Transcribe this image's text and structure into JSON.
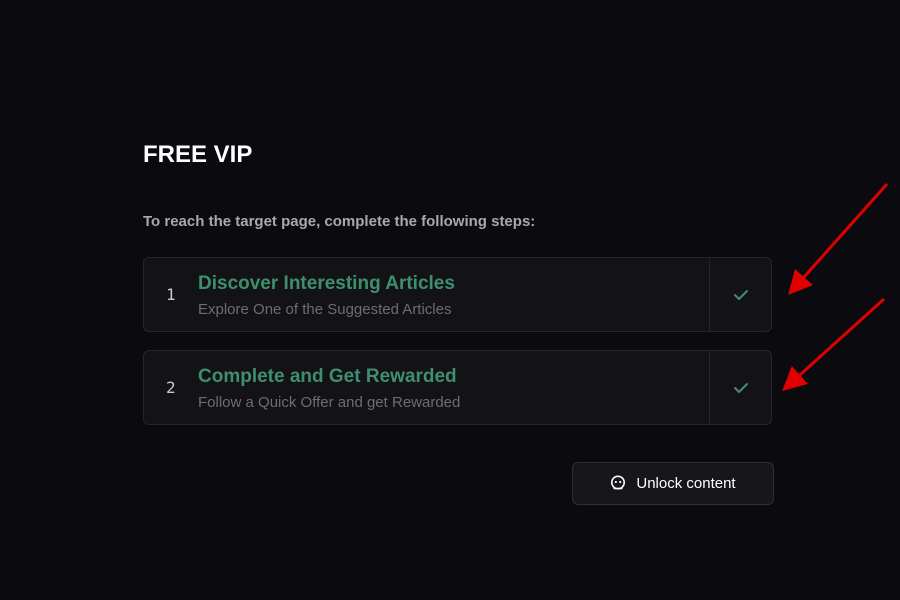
{
  "page": {
    "title": "FREE VIP",
    "subtitle": "To reach the target page, complete the following steps:"
  },
  "steps": [
    {
      "number": "1",
      "title": "Discover Interesting Articles",
      "description": "Explore One of the Suggested Articles",
      "icon": "check-icon"
    },
    {
      "number": "2",
      "title": "Complete and Get Rewarded",
      "description": "Follow a Quick Offer and get Rewarded",
      "icon": "check-icon"
    }
  ],
  "unlock_button": {
    "label": "Unlock content",
    "icon": "unlock-icon"
  },
  "colors": {
    "background": "#0b0b0f",
    "accent_green": "#3f8f6e",
    "annotation_red": "#e00000"
  }
}
